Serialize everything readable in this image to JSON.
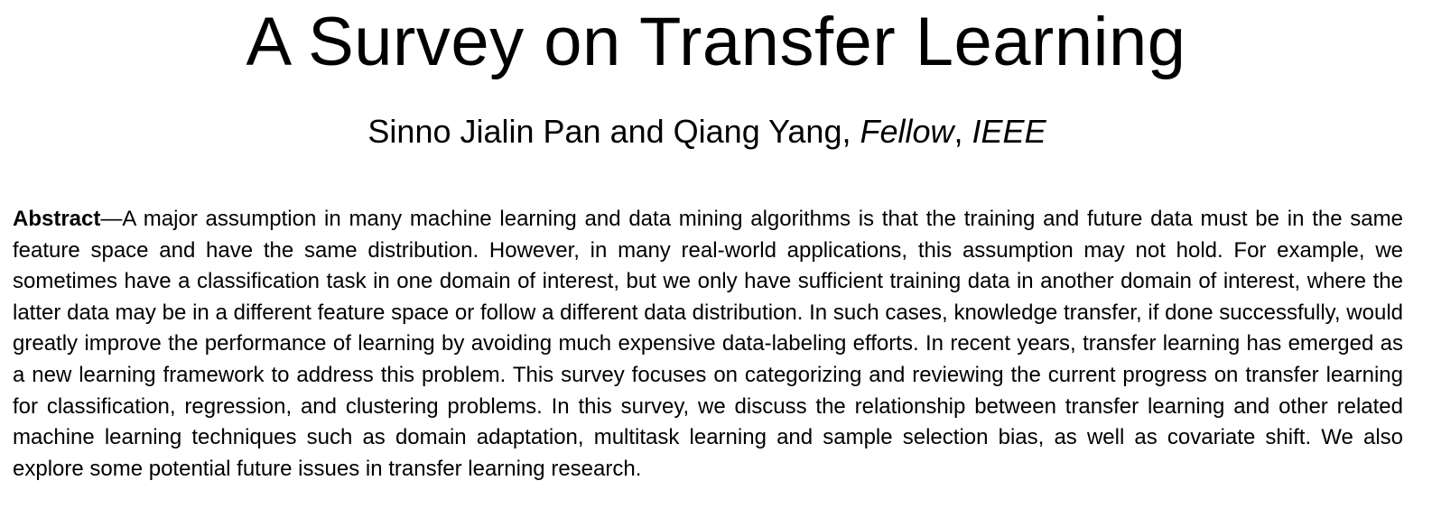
{
  "paper": {
    "title": "A Survey on Transfer Learning",
    "authors": "Sinno Jialin Pan and Qiang Yang,",
    "author_suffix_1": "Fellow",
    "author_suffix_sep": ",",
    "author_suffix_2": "IEEE",
    "abstract_label": "Abstract",
    "abstract_dash": "—",
    "abstract_text": "A major assumption in many machine learning and data mining algorithms is that the training and future data must be in the same feature space and have the same distribution. However, in many real-world applications, this assumption may not hold. For example, we sometimes have a classification task in one domain of interest, but we only have sufficient training data in another domain of interest, where the latter data may be in a different feature space or follow a different data distribution. In such cases, knowledge transfer, if done successfully, would greatly improve the performance of learning by avoiding much expensive data-labeling efforts. In recent years, transfer learning has emerged as a new learning framework to address this problem. This survey focuses on categorizing and reviewing the current progress on transfer learning for classification, regression, and clustering problems. In this survey, we discuss the relationship between transfer learning and other related machine learning techniques such as domain adaptation, multitask learning and sample selection bias, as well as covariate shift. We also explore some potential future issues in transfer learning research."
  }
}
